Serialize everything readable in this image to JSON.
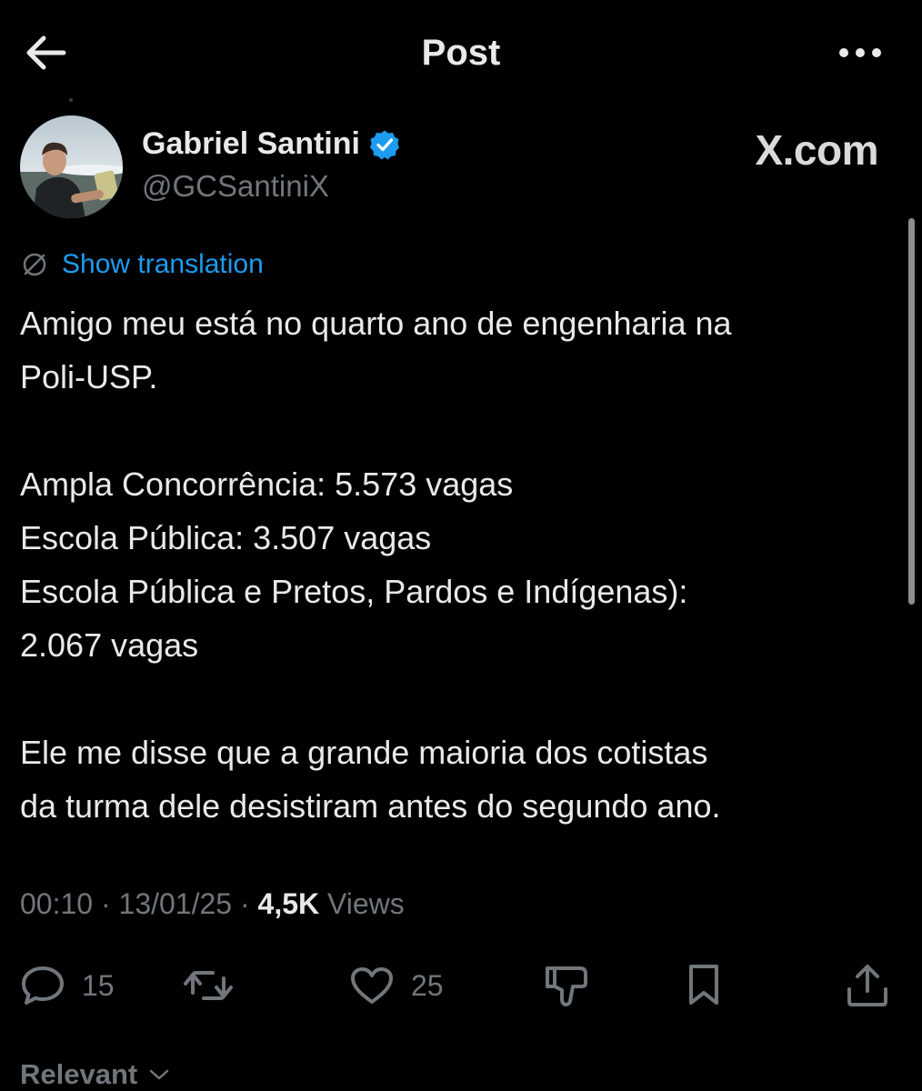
{
  "header": {
    "title": "Post",
    "back_icon": "arrow-left-icon",
    "more_icon": "more-horizontal-icon"
  },
  "author": {
    "name": "Gabriel Santini",
    "handle": "@GCSantiniX",
    "verified_icon": "verified-badge-icon",
    "source_label": "X.com"
  },
  "translation": {
    "label": "Show translation",
    "icon": "translate-globe-icon"
  },
  "post": {
    "lines": [
      "Amigo meu está no quarto ano de engenharia na",
      "Poli-USP.",
      "",
      "Ampla Concorrência: 5.573 vagas",
      "Escola Pública: 3.507 vagas",
      "Escola Pública e Pretos, Pardos e Indígenas):",
      "2.067 vagas",
      "",
      "Ele me disse que a grande maioria dos cotistas",
      "da turma dele desistiram antes do segundo ano."
    ]
  },
  "meta": {
    "time": "00:10",
    "date": "13/01/25",
    "views_count": "4,5K",
    "views_label": "Views",
    "separator": " · "
  },
  "actions": {
    "reply_count": "15",
    "like_count": "25"
  },
  "sort": {
    "label": "Relevant"
  },
  "colors": {
    "background": "#000000",
    "text": "#e7e9ea",
    "secondary": "#71767b",
    "accent": "#1d9bf0"
  }
}
